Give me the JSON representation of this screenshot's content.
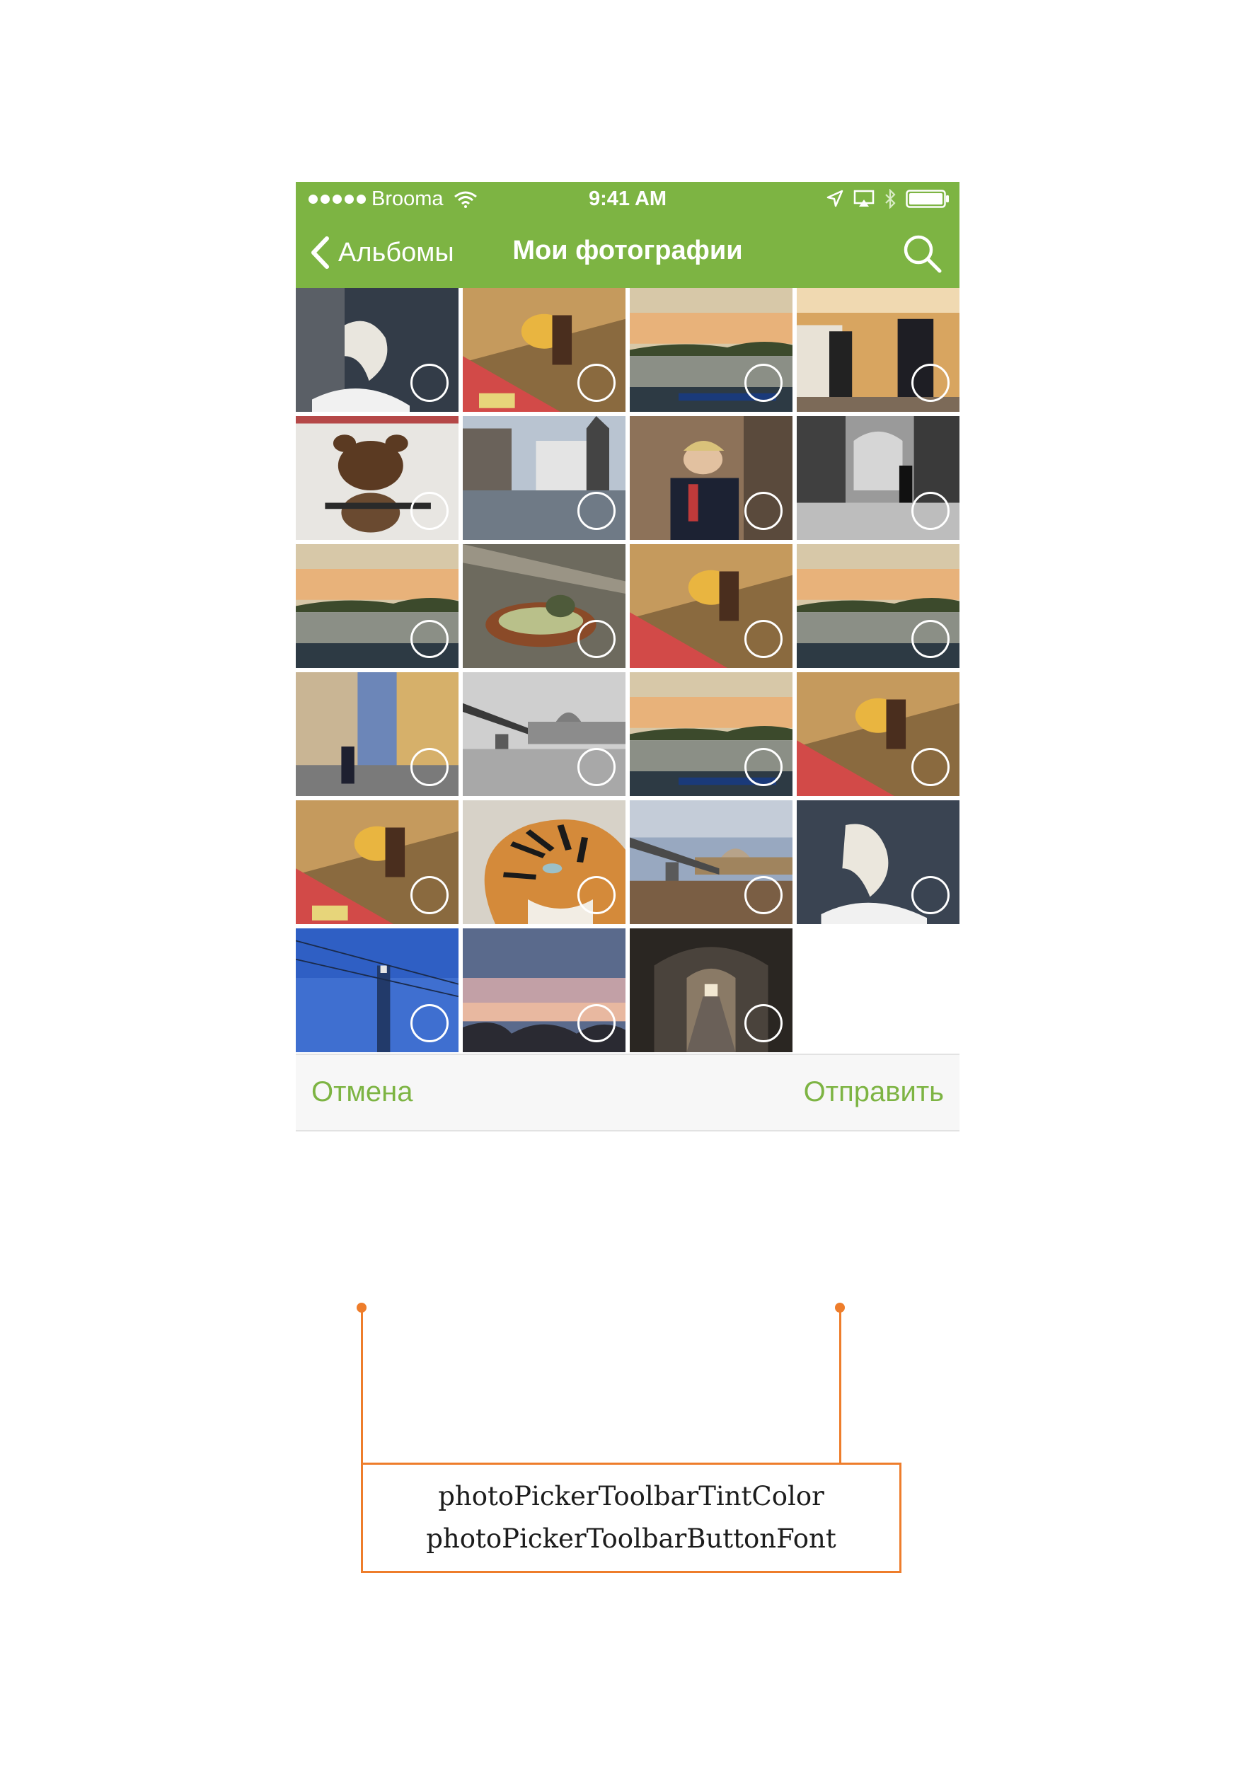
{
  "colors": {
    "accent": "#7db443",
    "annotation": "#ee7d2b"
  },
  "status_bar": {
    "carrier": "Brooma",
    "time": "9:41 AM",
    "icons": [
      "signal-dots-icon",
      "wifi-icon",
      "location-arrow-icon",
      "airplay-icon",
      "bluetooth-icon",
      "battery-icon"
    ]
  },
  "nav": {
    "back_label": "Альбомы",
    "title": "Мои фотографии",
    "icons": [
      "chevron-left-icon",
      "search-icon"
    ]
  },
  "photos": [
    {
      "subject": "polar bear statue"
    },
    {
      "subject": "street musician"
    },
    {
      "subject": "river sunset"
    },
    {
      "subject": "castle guard"
    },
    {
      "subject": "bear poster"
    },
    {
      "subject": "old town street"
    },
    {
      "subject": "guard portrait"
    },
    {
      "subject": "arcade street black and white"
    },
    {
      "subject": "river sunset"
    },
    {
      "subject": "bowl close-up"
    },
    {
      "subject": "street musician"
    },
    {
      "subject": "river sunset"
    },
    {
      "subject": "narrow street"
    },
    {
      "subject": "bridge black and white"
    },
    {
      "subject": "river sunset"
    },
    {
      "subject": "street musician"
    },
    {
      "subject": "street musician"
    },
    {
      "subject": "tiger"
    },
    {
      "subject": "bridge and dome"
    },
    {
      "subject": "polar bear statue"
    },
    {
      "subject": "lamp post and sky"
    },
    {
      "subject": "evening sky"
    },
    {
      "subject": "lit tunnel"
    }
  ],
  "toolbar": {
    "cancel_label": "Отмена",
    "send_label": "Отправить"
  },
  "annotation": {
    "line1": "photoPickerToolbarTintColor",
    "line2": "photoPickerToolbarButtonFont"
  }
}
